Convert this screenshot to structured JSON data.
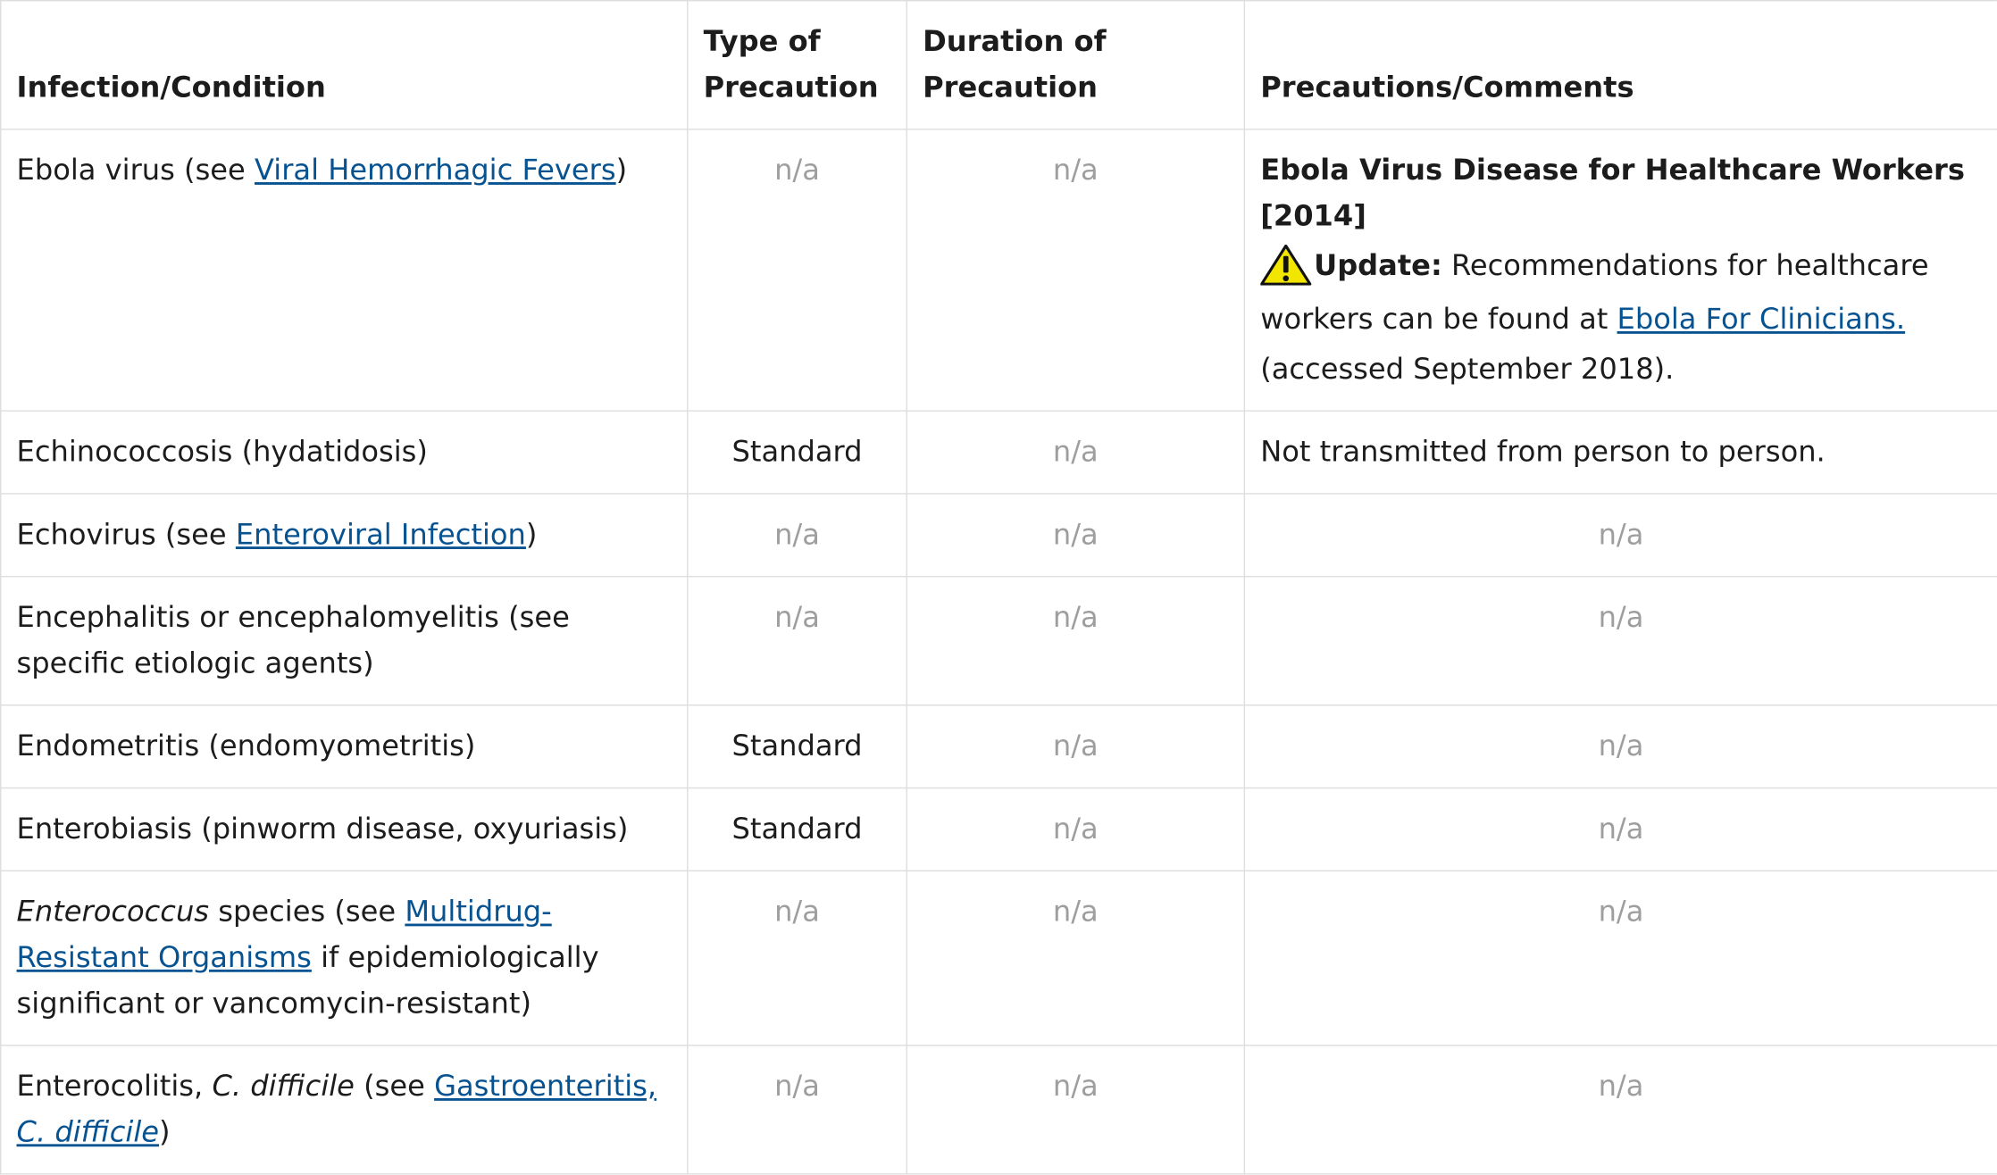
{
  "headers": {
    "col1": "Infection/Condition",
    "col2": "Type of Precaution",
    "col3": "Duration of Precaution",
    "col4": "Precautions/Comments"
  },
  "na": "n/a",
  "rows": {
    "ebola": {
      "prefix": "Ebola virus (see ",
      "link": "Viral Hemorrhagic Fevers",
      "suffix": ")",
      "type": "n/a",
      "duration": "n/a",
      "comment_title": "Ebola Virus Disease for Healthcare Workers [2014]",
      "update_label": "Update:",
      "update_text": " Recommendations for healthcare workers can be found at ",
      "update_link": "Ebola For Clinicians.",
      "update_tail": "(accessed September 2018)."
    },
    "echinococcosis": {
      "name": "Echinococcosis (hydatidosis)",
      "type": "Standard",
      "duration": "n/a",
      "comment": "Not transmitted from person to person."
    },
    "echovirus": {
      "prefix": "Echovirus (see ",
      "link": "Enteroviral Infection",
      "suffix": ")",
      "type": "n/a",
      "duration": "n/a",
      "comment": "n/a"
    },
    "encephalitis": {
      "name": "Encephalitis or encephalomyelitis (see specific etiologic agents)",
      "type": "n/a",
      "duration": "n/a",
      "comment": "n/a"
    },
    "endometritis": {
      "name": "Endometritis (endomyometritis)",
      "type": "Standard",
      "duration": "n/a",
      "comment": "n/a"
    },
    "enterobiasis": {
      "name": "Enterobiasis (pinworm disease, oxyuriasis)",
      "type": "Standard",
      "duration": "n/a",
      "comment": "n/a"
    },
    "enterococcus": {
      "italic": "Enterococcus",
      "prefix": " species (see ",
      "link": "Multidrug-Resistant Organisms",
      "suffix": " if epidemiologically significant or vancomycin-resistant)",
      "type": "n/a",
      "duration": "n/a",
      "comment": "n/a"
    },
    "enterocolitis": {
      "prefix": "Enterocolitis, ",
      "italic": "C. difficile",
      "mid": " (see ",
      "link_plain": "Gastroenteritis, ",
      "link_italic": "C. difficile",
      "suffix": ")",
      "type": "n/a",
      "duration": "n/a",
      "comment": "n/a"
    }
  },
  "icons": {
    "warning": "warning-triangle-icon",
    "warning_color": "#f2e600"
  }
}
